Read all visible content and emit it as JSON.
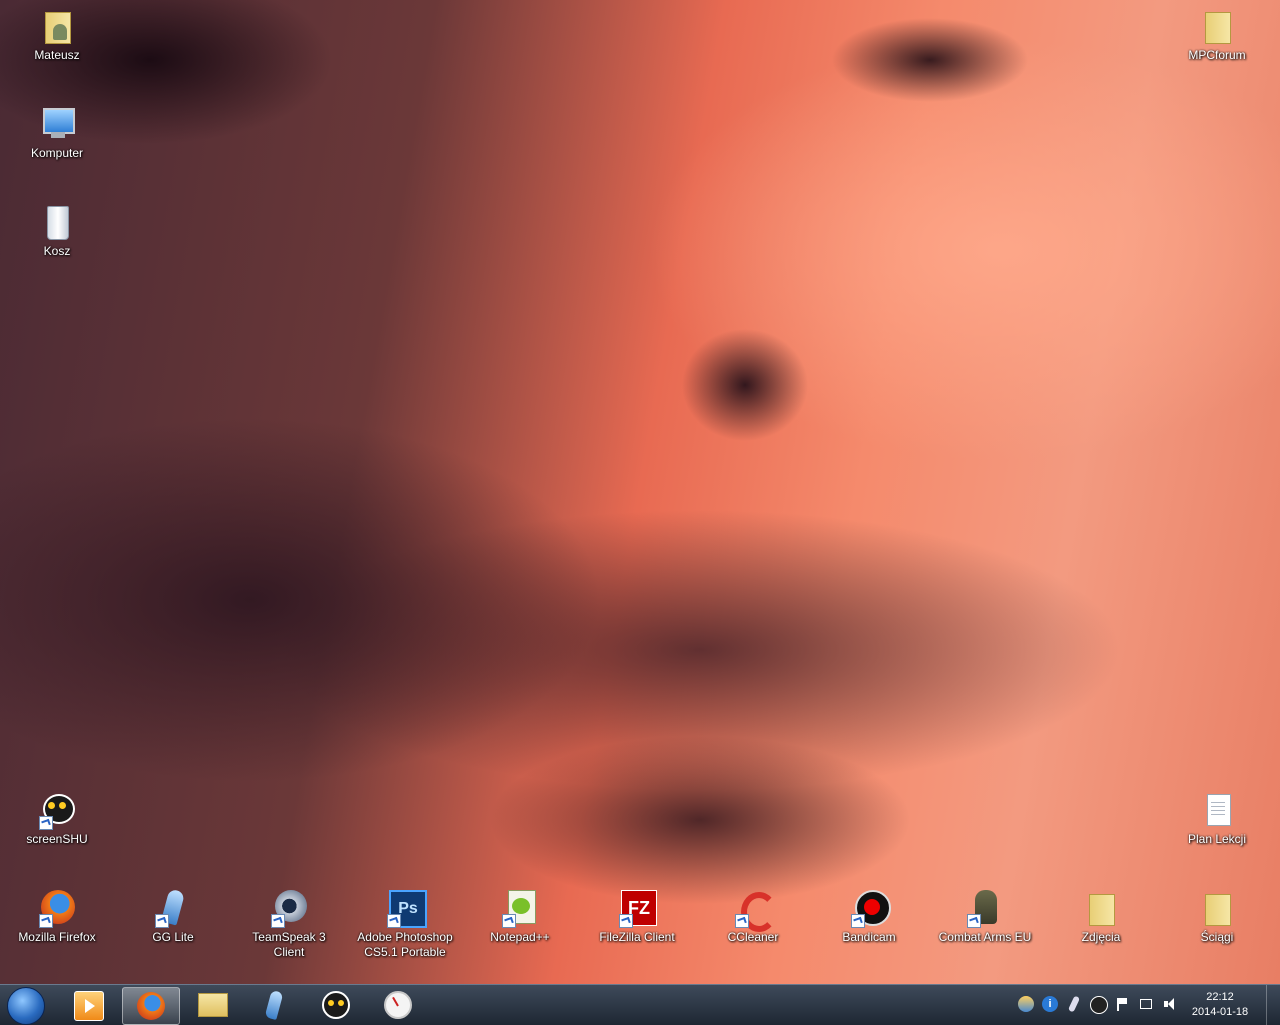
{
  "desktop": {
    "icons_left": [
      {
        "id": "mateusz",
        "label": "Mateusz",
        "icon": "user-folder-icon"
      },
      {
        "id": "komputer",
        "label": "Komputer",
        "icon": "computer-icon"
      },
      {
        "id": "kosz",
        "label": "Kosz",
        "icon": "recycle-bin-icon"
      },
      {
        "id": "screenshu",
        "label": "screenSHU",
        "icon": "lemur-icon"
      }
    ],
    "icons_right": [
      {
        "id": "mpcforum",
        "label": "MPCforum",
        "icon": "folder-icon"
      },
      {
        "id": "plan-lekcji",
        "label": "Plan Lekcji",
        "icon": "text-document-icon"
      }
    ],
    "icons_bottom": [
      {
        "id": "firefox",
        "label": "Mozilla Firefox",
        "icon": "firefox-icon"
      },
      {
        "id": "gglite",
        "label": "GG Lite",
        "icon": "gg-lite-icon"
      },
      {
        "id": "teamspeak",
        "label": "TeamSpeak 3 Client",
        "icon": "teamspeak-icon"
      },
      {
        "id": "photoshop",
        "label_line1": "Adobe Photoshop",
        "label_line2": "CS5.1 Portable",
        "icon": "photoshop-icon"
      },
      {
        "id": "notepadpp",
        "label": "Notepad++",
        "icon": "notepadpp-icon"
      },
      {
        "id": "filezilla",
        "label": "FileZilla Client",
        "icon": "filezilla-icon"
      },
      {
        "id": "ccleaner",
        "label": "CCleaner",
        "icon": "ccleaner-icon"
      },
      {
        "id": "bandicam",
        "label": "Bandicam",
        "icon": "bandicam-icon"
      },
      {
        "id": "combatarms",
        "label": "Combat Arms EU",
        "icon": "soldier-icon"
      },
      {
        "id": "zdjecia",
        "label": "Zdjęcia",
        "icon": "folder-icon"
      },
      {
        "id": "sciagi",
        "label": "Ściągi",
        "icon": "folder-icon"
      }
    ]
  },
  "taskbar": {
    "pinned": [
      "media-player-icon",
      "firefox-icon",
      "explorer-folder-icon",
      "gg-lite-icon",
      "lemur-icon",
      "clock-app-icon"
    ],
    "tray_icons": [
      "weather-icon",
      "info-icon",
      "gg-tray-icon",
      "lemur-tray-icon",
      "action-center-flag-icon",
      "network-icon",
      "volume-icon"
    ],
    "time": "22:12",
    "date": "2014-01-18"
  },
  "colors": {
    "accent": "#2a6bc0",
    "sky_light": "#f58a6c",
    "cloud_dark": "#3a2228"
  }
}
